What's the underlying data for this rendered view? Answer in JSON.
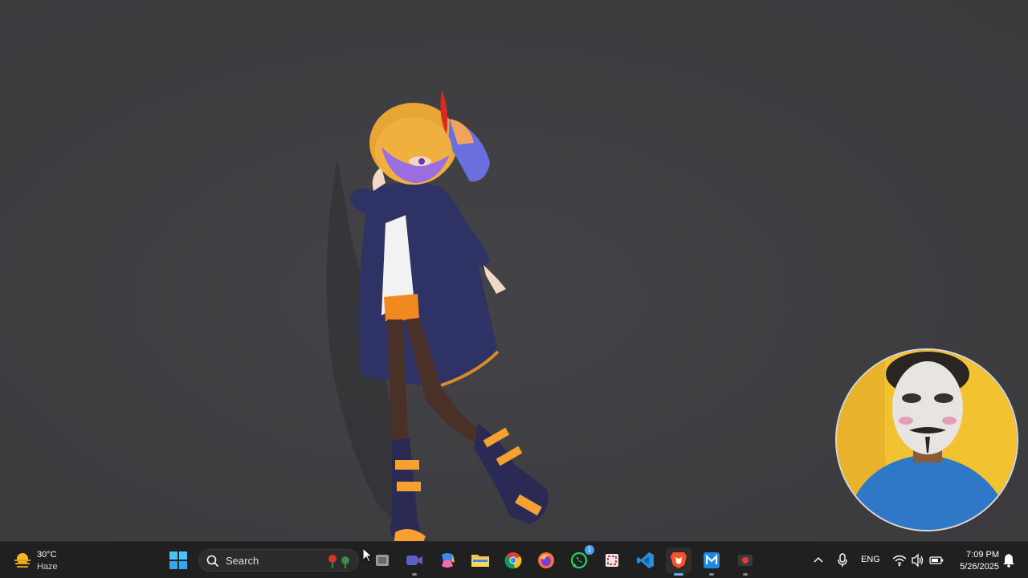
{
  "weather": {
    "temperature": "30°C",
    "condition": "Haze",
    "icon": "sun-haze-icon"
  },
  "search": {
    "placeholder": "Search"
  },
  "taskbar": {
    "pinned": [
      {
        "name": "start-button",
        "icon": "windows-logo-icon"
      },
      {
        "name": "task-view-button",
        "icon": "task-view-icon"
      },
      {
        "name": "meet-button",
        "icon": "video-camera-icon"
      },
      {
        "name": "copilot-button",
        "icon": "copilot-icon"
      },
      {
        "name": "file-explorer-button",
        "icon": "folder-icon"
      },
      {
        "name": "chrome-button",
        "icon": "chrome-icon"
      },
      {
        "name": "firefox-button",
        "icon": "firefox-icon"
      },
      {
        "name": "whatsapp-button",
        "icon": "whatsapp-icon",
        "badge": "1"
      },
      {
        "name": "snipping-tool-button",
        "icon": "snipping-tool-icon"
      },
      {
        "name": "vscode-button",
        "icon": "vscode-icon"
      },
      {
        "name": "brave-button",
        "icon": "brave-icon",
        "active": true
      },
      {
        "name": "mail-button",
        "icon": "mail-m-icon"
      },
      {
        "name": "recorder-button",
        "icon": "record-icon"
      }
    ]
  },
  "tray": {
    "language": "ENG",
    "time": "7:09 PM",
    "date": "5/26/2025"
  },
  "colors": {
    "desktop": "#3e3d40",
    "taskbar": "#202020",
    "accent": "#5fb2f2"
  }
}
